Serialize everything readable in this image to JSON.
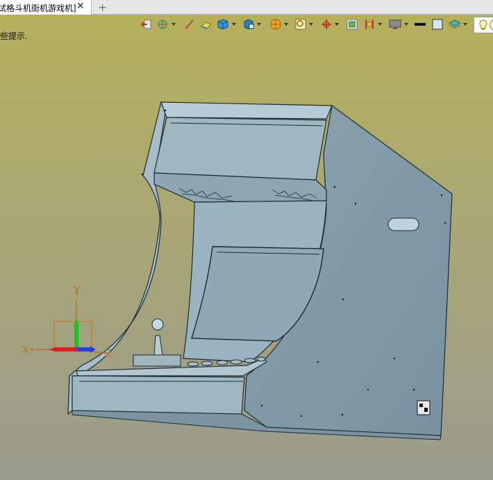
{
  "tab": {
    "title": "试格斗机街机游戏机]",
    "close_glyph": "✕",
    "add_glyph": "+"
  },
  "viewport": {
    "hint": "些提示.",
    "triad": {
      "x_label": "X",
      "y_label": "Y",
      "z_label": "Z"
    }
  },
  "toolbar": {
    "icons": [
      "previous-view-icon",
      "orient-icon",
      "paint-brush-icon",
      "eraser-icon",
      "shaded-cube-icon",
      "wireframe-cube-icon",
      "render-ball-icon",
      "zoom-window-icon",
      "pan-axis-icon",
      "section-view-icon",
      "clip-view-icon",
      "monitor-icon",
      "line-color-icon",
      "background-color-icon",
      "layers-icon",
      "lightbulb-icon"
    ]
  }
}
